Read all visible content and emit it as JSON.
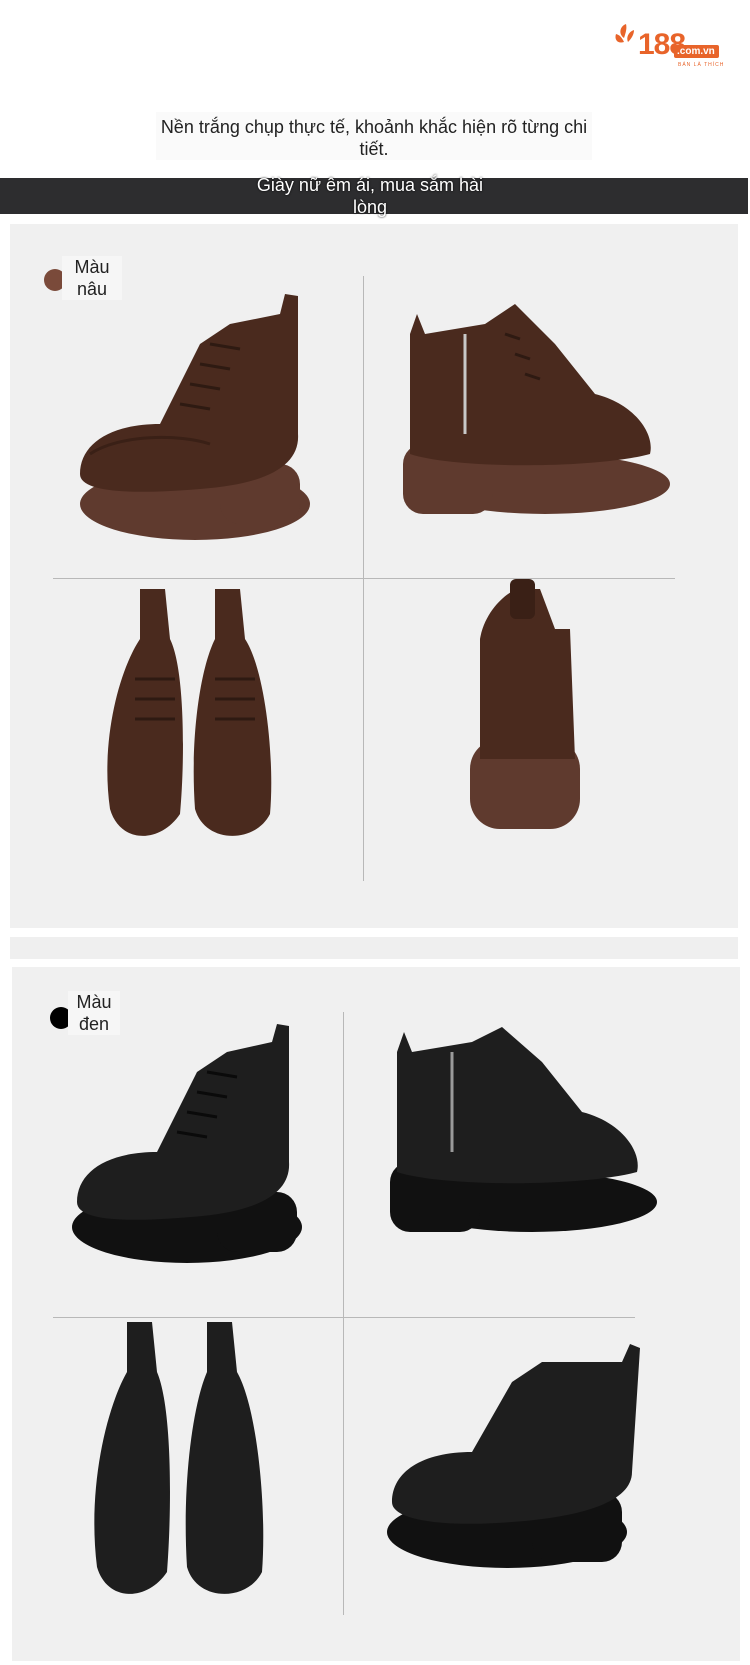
{
  "logo": {
    "number": "188",
    "domain": ".com.vn",
    "tagline": "BÁN LÀ THÍCH",
    "brand_color": "#e8642a"
  },
  "header": {
    "subtitle": "Nền trắng chụp thực tế, khoảnh khắc hiện rõ từng chi tiết.",
    "banner": "Giày nữ êm ái, mua sắm hài lòng"
  },
  "variants": [
    {
      "label": "Màu nâu",
      "glyph": "",
      "swatch_color": "#7a4a3a",
      "shoe_color": "#5a3324"
    },
    {
      "label": "Màu đen",
      "glyph": "",
      "swatch_color": "#000000",
      "shoe_color": "#1c1c1c"
    }
  ],
  "colors": {
    "banner_bg": "#2d2d2f",
    "panel_bg": "#f0f0f0",
    "divider": "#b8b8b8"
  }
}
